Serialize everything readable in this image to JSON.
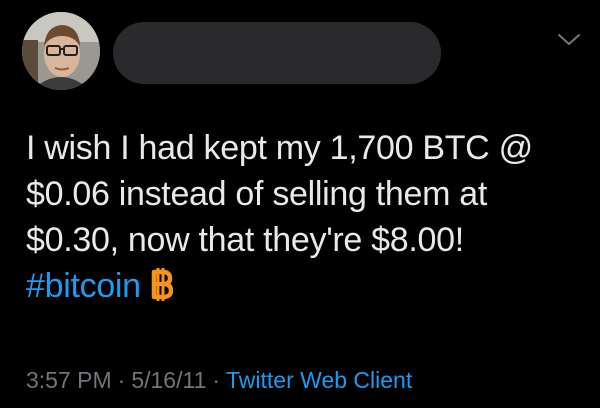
{
  "tweet": {
    "lines": [
      "I wish I had kept my 1,700 BTC @",
      "$0.06 instead of selling them at",
      "$0.30, now that they're $8.00!"
    ],
    "hashtag": "#bitcoin",
    "hashtag_emoji": "bitcoin-symbol-icon"
  },
  "meta": {
    "time": "3:57 PM",
    "separator": "·",
    "date": "5/16/11",
    "client": "Twitter Web Client"
  },
  "colors": {
    "background": "#000000",
    "text": "#e7e9ea",
    "link": "#1d9bf0",
    "muted": "#71767b",
    "bitcoin": "#f7931a",
    "redaction": "#2a2a2c"
  }
}
